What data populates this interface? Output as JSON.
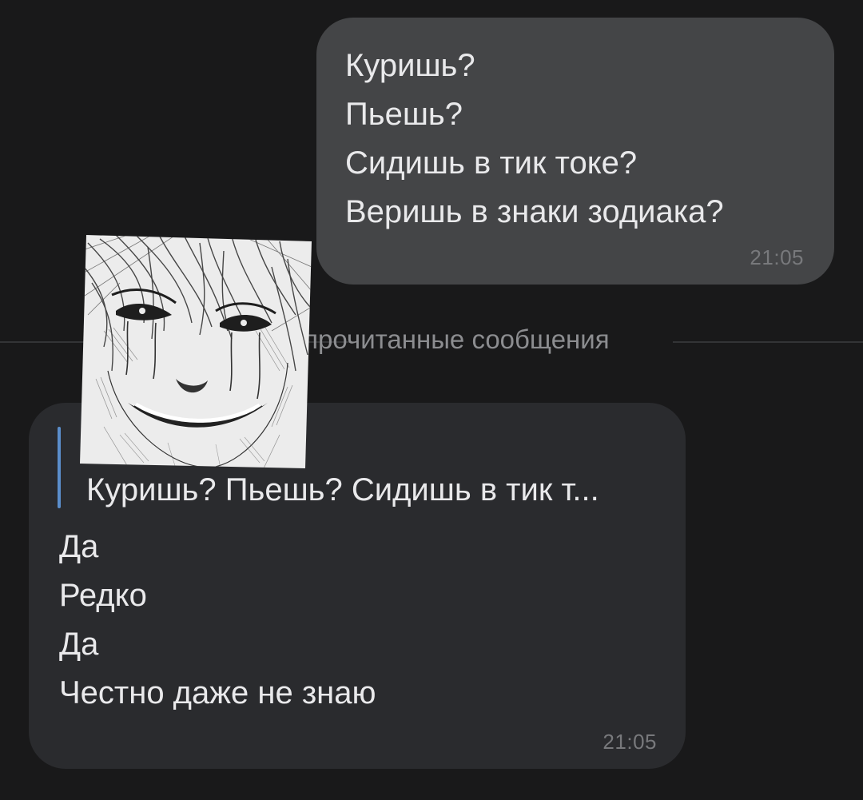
{
  "outgoing_message": {
    "lines": [
      "Куришь?",
      "Пьешь?",
      "Сидишь в тик токе?",
      "Веришь в знаки зодиака?"
    ],
    "time": "21:05"
  },
  "unread_divider": {
    "label": "Непрочитанные сообщения"
  },
  "sticker": {
    "icon": "anime-crying-face-sticker"
  },
  "incoming_message": {
    "reply_quote": "Куришь? Пьешь? Сидишь в тик т...",
    "lines": [
      "Да",
      "Редко",
      "Да",
      "Честно даже не знаю"
    ],
    "time": "21:05"
  },
  "colors": {
    "background": "#19191a",
    "outgoing_bubble": "#444547",
    "incoming_bubble": "#2a2b2e",
    "reply_accent": "#5b8ecb",
    "time_text": "#78797c"
  }
}
